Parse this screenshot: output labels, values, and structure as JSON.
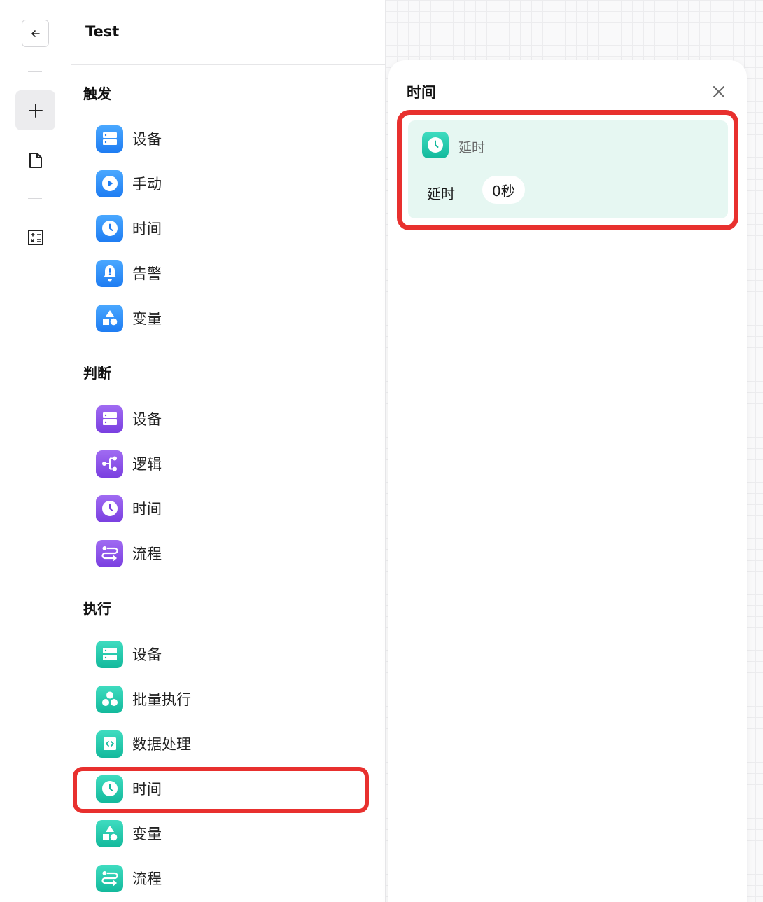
{
  "rail": {
    "back_icon": "arrow-left-icon",
    "add_icon": "plus-icon",
    "doc_icon": "document-icon",
    "calc_icon": "calculator-icon"
  },
  "palette": {
    "title": "Test",
    "sections": [
      {
        "title": "触发",
        "color": "#1e7cf2",
        "items": [
          {
            "label": "设备",
            "icon": "device-icon"
          },
          {
            "label": "手动",
            "icon": "play-icon"
          },
          {
            "label": "时间",
            "icon": "clock-icon"
          },
          {
            "label": "告警",
            "icon": "alarm-bell-icon"
          },
          {
            "label": "变量",
            "icon": "shapes-icon"
          }
        ]
      },
      {
        "title": "判断",
        "color": "#7a3fe0",
        "items": [
          {
            "label": "设备",
            "icon": "device-icon"
          },
          {
            "label": "逻辑",
            "icon": "branch-icon"
          },
          {
            "label": "时间",
            "icon": "clock-icon"
          },
          {
            "label": "流程",
            "icon": "flow-icon"
          }
        ]
      },
      {
        "title": "执行",
        "color": "#13b99c",
        "items": [
          {
            "label": "设备",
            "icon": "device-icon"
          },
          {
            "label": "批量执行",
            "icon": "batch-icon"
          },
          {
            "label": "数据处理",
            "icon": "code-icon"
          },
          {
            "label": "时间",
            "icon": "clock-icon"
          },
          {
            "label": "变量",
            "icon": "shapes-icon"
          },
          {
            "label": "流程",
            "icon": "flow-icon"
          }
        ]
      }
    ]
  },
  "detail": {
    "title": "时间",
    "close_icon": "close-icon",
    "card": {
      "icon": "clock-icon",
      "name": "延时",
      "param_label": "延时",
      "param_value": "0秒"
    }
  },
  "colors": {
    "highlight": "#e8302e",
    "card_bg": "#e6f7f2"
  }
}
